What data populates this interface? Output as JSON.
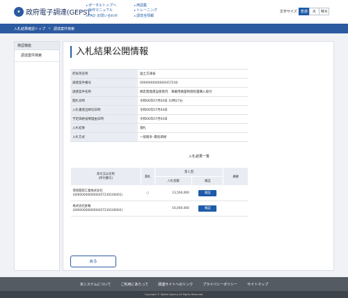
{
  "header": {
    "logo_mark": "e",
    "site_name": "政府電子調達(GEPS)",
    "links_col1": [
      "ポータルトップへ",
      "操作マニュアル",
      "FAQ･お問い合わせ"
    ],
    "links_col2": [
      "用語集",
      "トレーニング",
      "調達全情報"
    ],
    "font_size_label": "文字サイズ",
    "font_size_options": [
      "普通",
      "大",
      "特大"
    ],
    "font_size_selected": "普通"
  },
  "breadcrumb": [
    "入札結果確認トップ",
    "調達案件検索"
  ],
  "sidebar": {
    "heading": "検証機能",
    "items": [
      "調達案件検索"
    ]
  },
  "main": {
    "title": "入札結果公開情報",
    "info": [
      {
        "key": "府省等名称",
        "value": "国土交通省"
      },
      {
        "key": "調達案件番号",
        "value": "0000000000000457230"
      },
      {
        "key": "調達案件名称",
        "value": "網走開発建設部管内　車載用路面制御装置購入取付"
      },
      {
        "key": "開札日時",
        "value": "令和06年07月04日 10時27分"
      },
      {
        "key": "入札書提出締切日時",
        "value": "令和06年07月04日"
      },
      {
        "key": "予定価格省略理由日時",
        "value": "令和06年07月04日"
      },
      {
        "key": "入札結果",
        "value": "落札"
      },
      {
        "key": "入札方式",
        "value": "一般競争･最低価格"
      }
    ],
    "result_list_title": "入札結果一覧",
    "result_table": {
      "col_name": "商号又は名称\n(所付番号)",
      "col_award": "落札",
      "col_round": "第１回",
      "col_amount": "入札金額",
      "col_verify": "検証",
      "col_remarks": "摘要",
      "rows": [
        {
          "name": "環境開発工業株式会社",
          "code": "(0000000000000457230100001)",
          "award": "○",
          "amount": "13,500,000",
          "verify": "検証",
          "remarks": ""
        },
        {
          "name": "株式会社倉輌",
          "code": "(0000000000000457230100002)",
          "award": "",
          "amount": "16,000,000",
          "verify": "検証",
          "remarks": ""
        }
      ]
    },
    "back_label": "戻る"
  },
  "footer": {
    "links": [
      "本システムについて",
      "ご利用にあたって",
      "関連サイトへのリンク",
      "プライバシーポリシー",
      "サイトマップ"
    ],
    "copyright": "Copyright © Digital Agency All Rights Reserved."
  },
  "colors": {
    "brand": "#2c5aa0",
    "link": "#1f5ba8",
    "footer": "#555b63"
  }
}
